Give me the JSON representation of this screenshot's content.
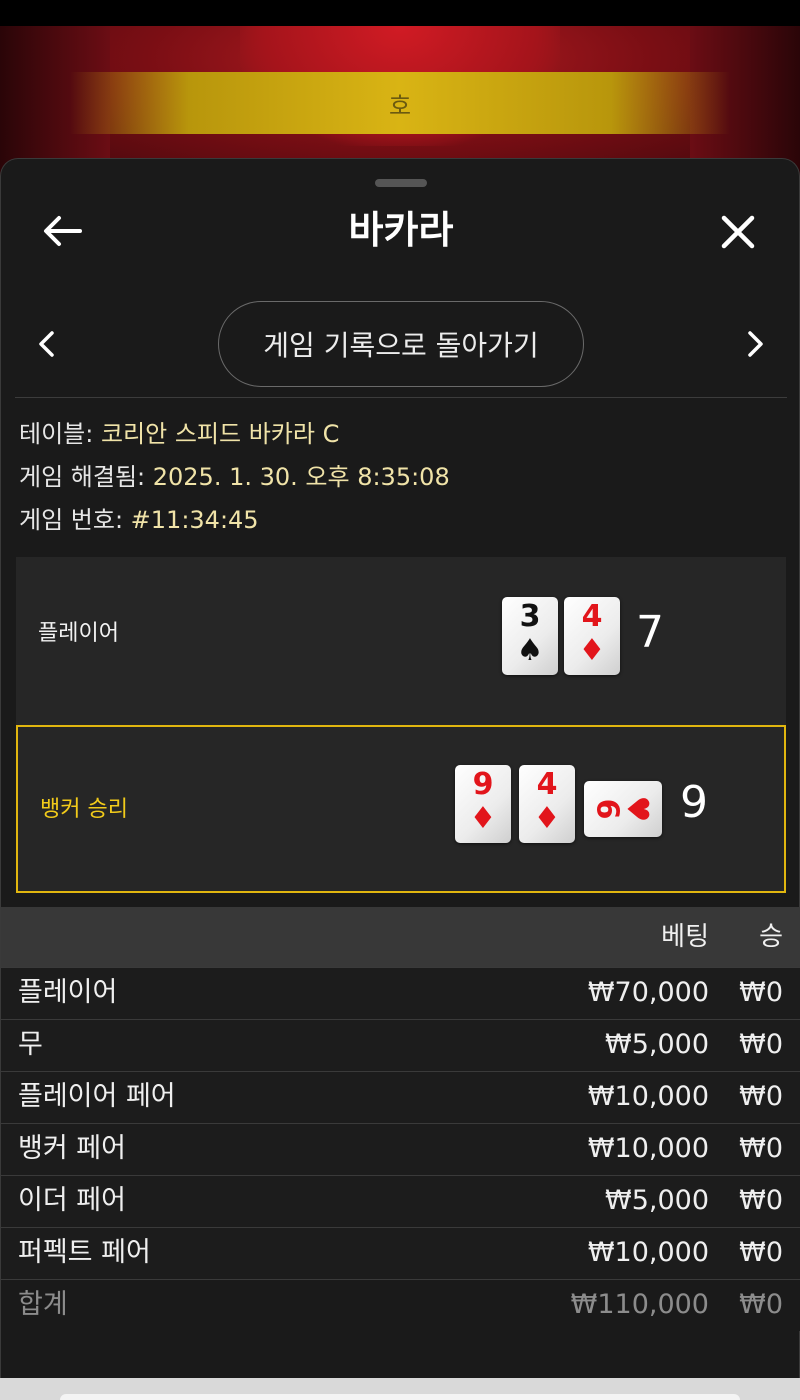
{
  "road_banner": {
    "text": "호"
  },
  "header": {
    "title": "바카라"
  },
  "nav": {
    "history_button": "게임 기록으로 돌아가기"
  },
  "info": {
    "table_label": "테이블: ",
    "table_value": "코리안 스피드 바카라 C",
    "resolved_label": "게임 해결됨: ",
    "resolved_value": "2025. 1. 30. 오후 8:35:08",
    "game_no_label": "게임 번호: ",
    "game_no_value": "#11:34:45"
  },
  "player": {
    "label": "플레이어",
    "score": "7",
    "cards": [
      {
        "rank": "3",
        "suit": "♠",
        "color": "#111111"
      },
      {
        "rank": "4",
        "suit": "♦",
        "color": "#e2151b"
      }
    ]
  },
  "banker": {
    "label": "뱅커 승리",
    "score": "9",
    "highlight_color": "#e1b60f",
    "cards": [
      {
        "rank": "9",
        "suit": "♦",
        "color": "#e2151b"
      },
      {
        "rank": "4",
        "suit": "♦",
        "color": "#e2151b"
      },
      {
        "rank": "6",
        "suit": "♥",
        "color": "#e2151b",
        "sideways": true
      }
    ]
  },
  "bets": {
    "header_bet": "베팅",
    "header_win": "승",
    "rows": [
      {
        "name": "플레이어",
        "bet": "₩70,000",
        "win": "₩0"
      },
      {
        "name": "무",
        "bet": "₩5,000",
        "win": "₩0"
      },
      {
        "name": "플레이어 페어",
        "bet": "₩10,000",
        "win": "₩0"
      },
      {
        "name": "뱅커 페어",
        "bet": "₩10,000",
        "win": "₩0"
      },
      {
        "name": "이더 페어",
        "bet": "₩5,000",
        "win": "₩0"
      },
      {
        "name": "퍼펙트 페어",
        "bet": "₩10,000",
        "win": "₩0"
      }
    ],
    "total": {
      "name": "합계",
      "bet": "₩110,000",
      "win": "₩0"
    }
  }
}
